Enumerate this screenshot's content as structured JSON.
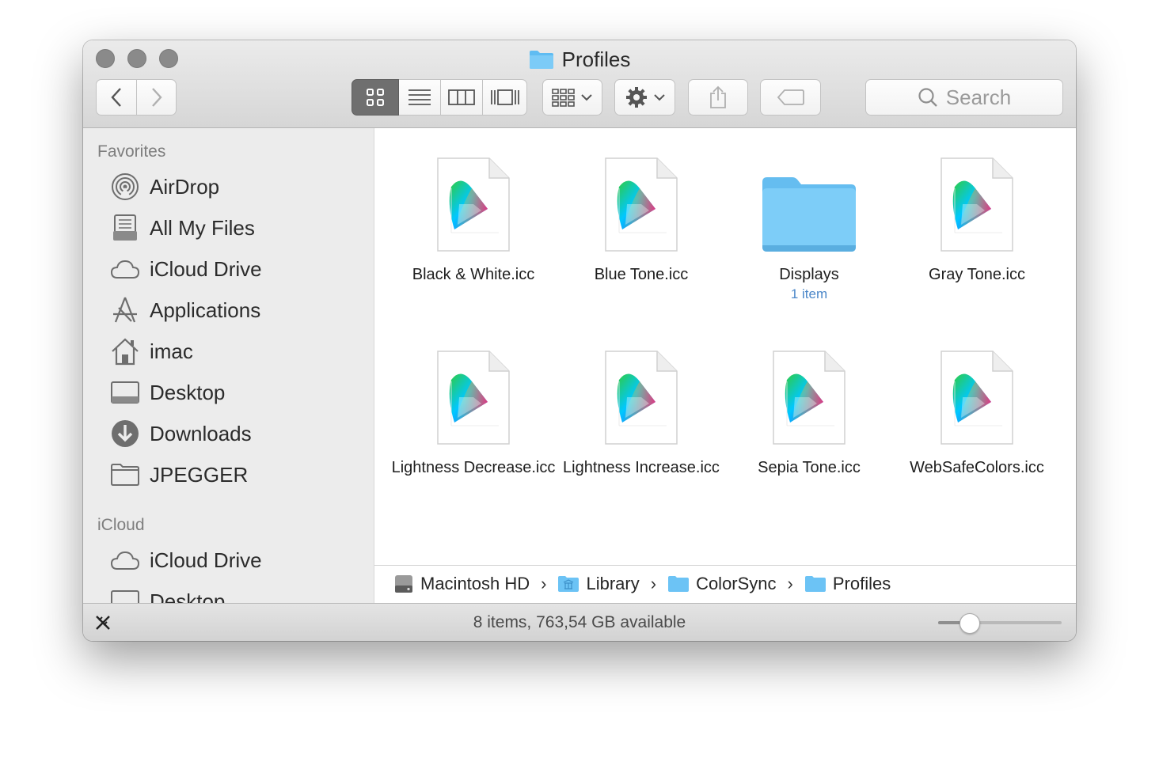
{
  "window": {
    "title": "Profiles",
    "accent": "#6f6f6f"
  },
  "toolbar": {
    "back_icon": "chevron-left-icon",
    "forward_icon": "chevron-right-icon",
    "view_modes": [
      "icon-view",
      "list-view",
      "column-view",
      "cover-flow-view"
    ],
    "active_view": "icon-view",
    "search_placeholder": "Search"
  },
  "sidebar": {
    "favorites_header": "Favorites",
    "favorites": [
      {
        "label": "AirDrop",
        "icon": "airdrop-icon"
      },
      {
        "label": "All My Files",
        "icon": "all-my-files-icon"
      },
      {
        "label": "iCloud Drive",
        "icon": "cloud-icon"
      },
      {
        "label": "Applications",
        "icon": "applications-icon"
      },
      {
        "label": "imac",
        "icon": "home-icon"
      },
      {
        "label": "Desktop",
        "icon": "desktop-icon"
      },
      {
        "label": "Downloads",
        "icon": "downloads-icon"
      },
      {
        "label": "JPEGGER",
        "icon": "folder-icon"
      }
    ],
    "icloud_header": "iCloud",
    "icloud": [
      {
        "label": "iCloud Drive",
        "icon": "cloud-icon"
      },
      {
        "label": "Desktop",
        "icon": "desktop-icon"
      }
    ]
  },
  "files": [
    {
      "name": "Black & White.icc",
      "kind": "icc"
    },
    {
      "name": "Blue Tone.icc",
      "kind": "icc"
    },
    {
      "name": "Displays",
      "kind": "folder",
      "sub": "1 item"
    },
    {
      "name": "Gray Tone.icc",
      "kind": "icc"
    },
    {
      "name": "Lightness Decrease.icc",
      "kind": "icc"
    },
    {
      "name": "Lightness Increase.icc",
      "kind": "icc"
    },
    {
      "name": "Sepia Tone.icc",
      "kind": "icc"
    },
    {
      "name": "WebSafeColors.icc",
      "kind": "icc"
    }
  ],
  "pathbar": [
    {
      "label": "Macintosh HD",
      "icon": "hard-drive-icon"
    },
    {
      "label": "Library",
      "icon": "library-folder-icon"
    },
    {
      "label": "ColorSync",
      "icon": "folder-icon"
    },
    {
      "label": "Profiles",
      "icon": "folder-icon"
    }
  ],
  "statusbar": {
    "text": "8 items, 763,54 GB available",
    "icon_size_fraction": 0.25
  }
}
